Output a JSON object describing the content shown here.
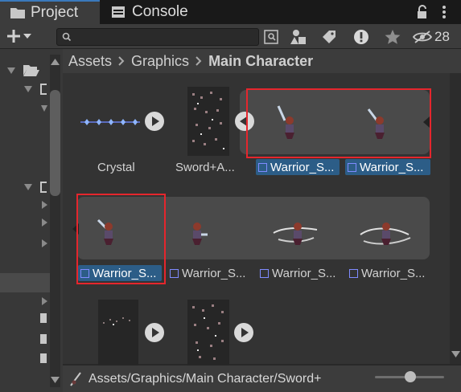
{
  "tabs": [
    {
      "label": "Project",
      "icon": "folder-icon"
    },
    {
      "label": "Console",
      "icon": "console-icon"
    }
  ],
  "toolbar": {
    "hidden_count": "28",
    "search_placeholder": ""
  },
  "breadcrumb": {
    "items": [
      "Assets",
      "Graphics",
      "Main Character"
    ]
  },
  "assets": {
    "crystal": "Crystal",
    "sword_sheet_top": "Sword+A...",
    "row1": [
      "Warrior_S...",
      "Warrior_S..."
    ],
    "row2": [
      "Warrior_S...",
      "Warrior_S...",
      "Warrior_S...",
      "Warrior_S..."
    ]
  },
  "status": {
    "path": "Assets/Graphics/Main Character/Sword+",
    "zoom": 0.6
  },
  "colors": {
    "accent": "#3a79bb",
    "selection": "#2c5d87",
    "highlight": "#e5262d"
  }
}
